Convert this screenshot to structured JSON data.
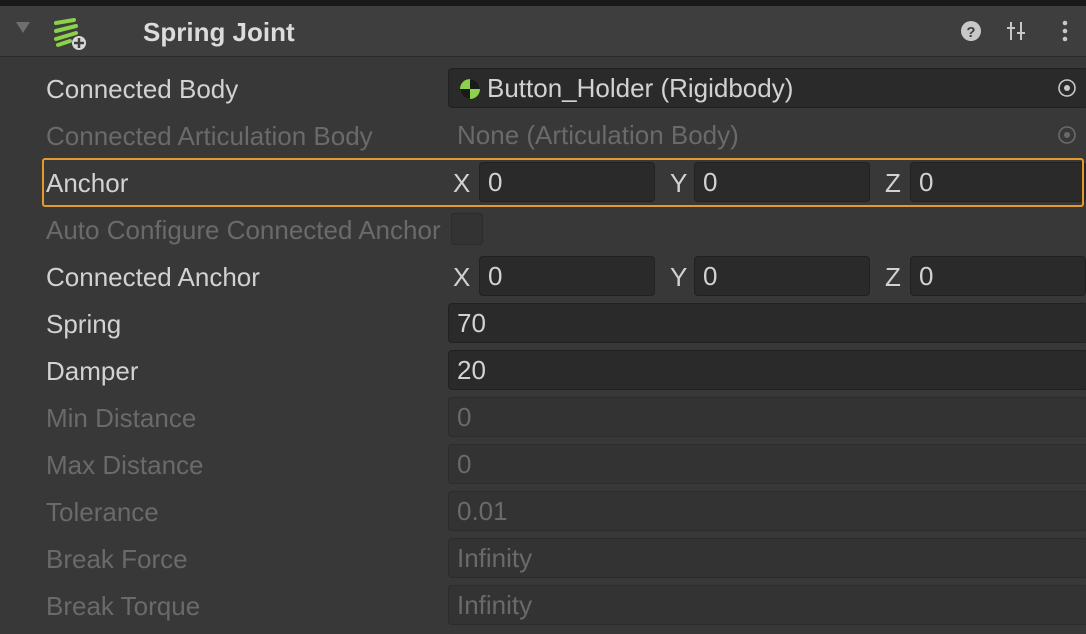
{
  "component": {
    "title": "Spring Joint",
    "icon": "spring-joint-icon",
    "header_icons": [
      "help-icon",
      "presets-icon",
      "kebab-menu-icon"
    ]
  },
  "fields": {
    "connected_body": {
      "label": "Connected Body",
      "value": "Button_Holder (Rigidbody)"
    },
    "connected_articulation_body": {
      "label": "Connected Articulation Body",
      "value": "None (Articulation Body)"
    },
    "anchor": {
      "label": "Anchor",
      "x_label": "X",
      "x": "0",
      "y_label": "Y",
      "y": "0",
      "z_label": "Z",
      "z": "0"
    },
    "auto_configure": {
      "label": "Auto Configure Connected Anchor",
      "checked": false
    },
    "connected_anchor": {
      "label": "Connected Anchor",
      "x_label": "X",
      "x": "0",
      "y_label": "Y",
      "y": "0",
      "z_label": "Z",
      "z": "0"
    },
    "spring": {
      "label": "Spring",
      "value": "70"
    },
    "damper": {
      "label": "Damper",
      "value": "20"
    },
    "min_distance": {
      "label": "Min Distance",
      "value": "0"
    },
    "max_distance": {
      "label": "Max Distance",
      "value": "0"
    },
    "tolerance": {
      "label": "Tolerance",
      "value": "0.01"
    },
    "break_force": {
      "label": "Break Force",
      "value": "Infinity"
    },
    "break_torque": {
      "label": "Break Torque",
      "value": "Infinity"
    }
  },
  "colors": {
    "background": "#383838",
    "field_background": "#2a2a2a",
    "highlight": "#e49a2b",
    "accent_green": "#8bd14a"
  }
}
